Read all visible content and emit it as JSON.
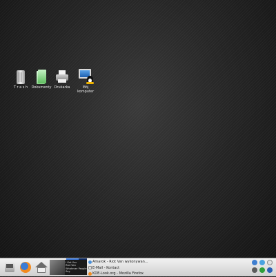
{
  "desktop": {
    "icons": [
      {
        "label": "T r a s h",
        "icon": "trash-icon"
      },
      {
        "label": "Dokumenty",
        "icon": "documents-folder-icon"
      },
      {
        "label": "Drukarka",
        "icon": "printer-icon"
      },
      {
        "label": "Mój\nkomputer",
        "icon": "computer-icon"
      }
    ]
  },
  "taskbar": {
    "launchers": [
      {
        "icon": "kde-menu-icon"
      },
      {
        "icon": "firefox-icon"
      },
      {
        "icon": "home-folder-icon"
      }
    ],
    "now_playing": {
      "line1": "I Got You",
      "line2": "Riot Van",
      "line3": "Whatever People Say",
      "progress": 0.6
    },
    "tasks": [
      {
        "label": "Amarok - Riot Van wykonywan...",
        "icon": "amarok-icon"
      },
      {
        "label": "E-Mail - Kontact",
        "icon": "mail-icon"
      },
      {
        "label": "KDE-Look.org - Mozilla Firefox",
        "icon": "firefox-icon"
      }
    ],
    "tray": [
      {
        "icon": "network-icon"
      },
      {
        "icon": "info-icon"
      },
      {
        "icon": "clock-icon"
      },
      {
        "icon": "volume-icon"
      },
      {
        "icon": "update-icon"
      },
      {
        "icon": "user-icon"
      }
    ]
  }
}
